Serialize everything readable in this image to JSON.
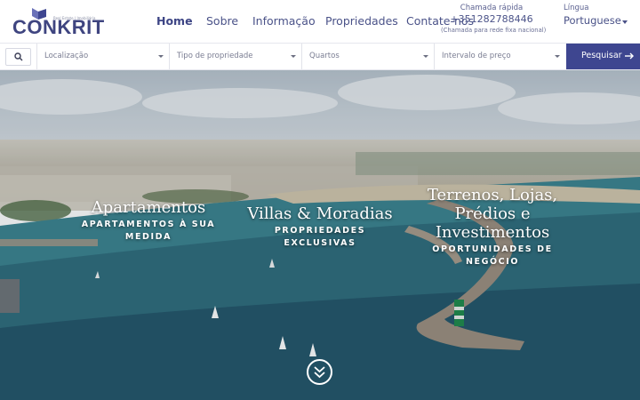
{
  "brand": {
    "name": "CONKRIT",
    "tagline": "Real Estate | Imobiliária",
    "colors": {
      "primary": "#3e4690",
      "accent": "#6a71b8"
    }
  },
  "nav": {
    "items": [
      {
        "label": "Home",
        "active": true
      },
      {
        "label": "Sobre",
        "active": false
      },
      {
        "label": "Informação",
        "active": false
      },
      {
        "label": "Propriedades",
        "active": false
      },
      {
        "label": "Contate-nos",
        "active": false
      }
    ]
  },
  "quick_call": {
    "label": "Chamada rápida",
    "number": "+351282788446",
    "note": "(Chamada para rede fixa nacional)"
  },
  "language": {
    "label": "Língua",
    "selected": "Portuguese"
  },
  "search": {
    "icon": "search-icon",
    "fields": [
      {
        "label": "Localização"
      },
      {
        "label": "Tipo de propriedade"
      },
      {
        "label": "Quartos"
      },
      {
        "label": "Intervalo de preço"
      }
    ],
    "button_label": "Pesquisar"
  },
  "hero": {
    "categories": [
      {
        "title": "Apartamentos",
        "subtitle": "APARTAMENTOS À SUA MEDIDA"
      },
      {
        "title": "Villas & Moradias",
        "subtitle": "PROPRIEDADES EXCLUSIVAS"
      },
      {
        "title": "Terrenos, Lojas, Prédios e Investimentos",
        "subtitle": "OPORTUNIDADES DE NEGÓCIO"
      }
    ],
    "scroll_icon": "double-chevron-down-icon"
  }
}
